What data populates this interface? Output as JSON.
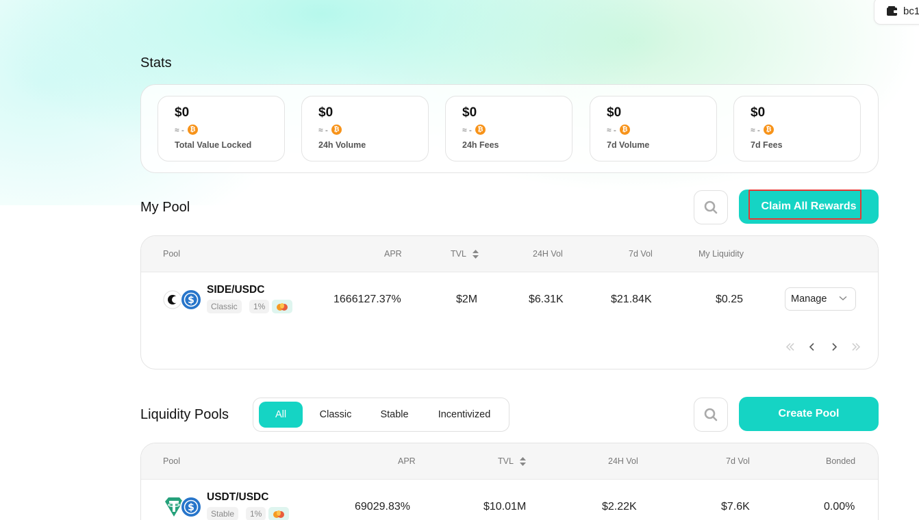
{
  "wallet": {
    "address": "bc1"
  },
  "stats": {
    "title": "Stats",
    "items": [
      {
        "value": "$0",
        "approx": "≈ -",
        "label": "Total Value Locked"
      },
      {
        "value": "$0",
        "approx": "≈ -",
        "label": "24h Volume"
      },
      {
        "value": "$0",
        "approx": "≈ -",
        "label": "24h Fees"
      },
      {
        "value": "$0",
        "approx": "≈ -",
        "label": "7d Volume"
      },
      {
        "value": "$0",
        "approx": "≈ -",
        "label": "7d Fees"
      }
    ]
  },
  "my_pool": {
    "title": "My Pool",
    "claim_label": "Claim All Rewards",
    "columns": {
      "pool": "Pool",
      "apr": "APR",
      "tvl": "TVL",
      "vol24": "24H Vol",
      "vol7d": "7d Vol",
      "liquidity": "My Liquidity"
    },
    "rows": [
      {
        "pair": "SIDE/USDC",
        "type": "Classic",
        "fee": "1%",
        "apr": "1666127.37%",
        "tvl": "$2M",
        "vol24": "$6.31K",
        "vol7d": "$21.84K",
        "liquidity": "$0.25",
        "manage": "Manage"
      }
    ]
  },
  "liquidity_pools": {
    "title": "Liquidity Pools",
    "filters": [
      "All",
      "Classic",
      "Stable",
      "Incentivized"
    ],
    "active_filter": "All",
    "create_label": "Create Pool",
    "columns": {
      "pool": "Pool",
      "apr": "APR",
      "tvl": "TVL",
      "vol24": "24H Vol",
      "vol7d": "7d Vol",
      "bonded": "Bonded"
    },
    "rows": [
      {
        "pair": "USDT/USDC",
        "type": "Stable",
        "fee": "1%",
        "apr": "69029.83%",
        "tvl": "$10.01M",
        "vol24": "$2.22K",
        "vol7d": "$7.6K",
        "bonded": "0.00%"
      }
    ]
  },
  "colors": {
    "accent": "#15d4c4",
    "btc": "#f7931a",
    "usdc": "#2775ca",
    "usdt": "#26a17b",
    "highlight": "#e53935"
  },
  "icons": [
    "wallet-icon",
    "bitcoin-icon",
    "search-icon",
    "sort-icon",
    "chevron-down-icon",
    "first-page-icon",
    "prev-page-icon",
    "next-page-icon",
    "last-page-icon",
    "side-token-icon",
    "usdc-token-icon",
    "usdt-token-icon",
    "reward-icon"
  ]
}
